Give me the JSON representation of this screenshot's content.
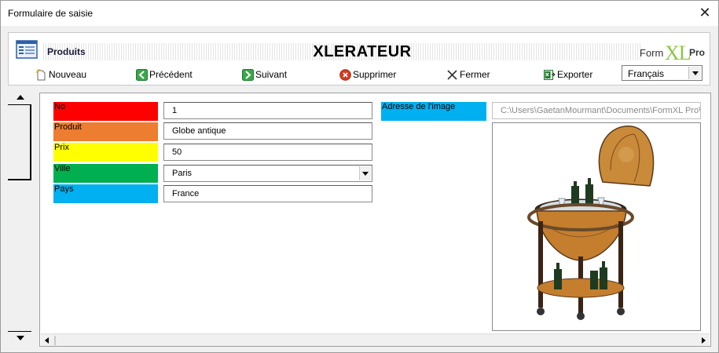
{
  "window": {
    "title": "Formulaire de saisie",
    "close_glyph": "✕"
  },
  "header": {
    "section_title": "Produits",
    "brand_title": "XLERATEUR",
    "logo": {
      "form": "Form",
      "xl": "XL",
      "pro": "Pro"
    }
  },
  "toolbar": {
    "new_label": "Nouveau",
    "previous_label": "Précédent",
    "next_label": "Suivant",
    "delete_label": "Supprimer",
    "close_label": "Fermer",
    "export_label": "Exporter",
    "language_value": "Français"
  },
  "colors": {
    "no": "#ff0000",
    "produit": "#ed7d31",
    "prix": "#ffff00",
    "ville": "#00b050",
    "pays": "#00b0f0",
    "image_label": "#00b0f0"
  },
  "fields": [
    {
      "label": "No",
      "value": "1"
    },
    {
      "label": "Produit",
      "value": "Globe antique"
    },
    {
      "label": "Prix",
      "value": "50"
    },
    {
      "label": "Ville",
      "value": "Paris"
    },
    {
      "label": "Pays",
      "value": "France"
    }
  ],
  "image": {
    "label": "Adresse de l'image",
    "path": "C:\\Users\\GaetanMourmant\\Documents\\FormXL Pro\\g",
    "subject": "globe-bar-image"
  },
  "icons": {
    "app": "form-list-icon",
    "new": "new-document-icon",
    "previous": "green-left-arrow-icon",
    "next": "green-right-arrow-icon",
    "delete": "red-x-circle-icon",
    "close": "black-x-icon",
    "export": "excel-export-icon"
  }
}
